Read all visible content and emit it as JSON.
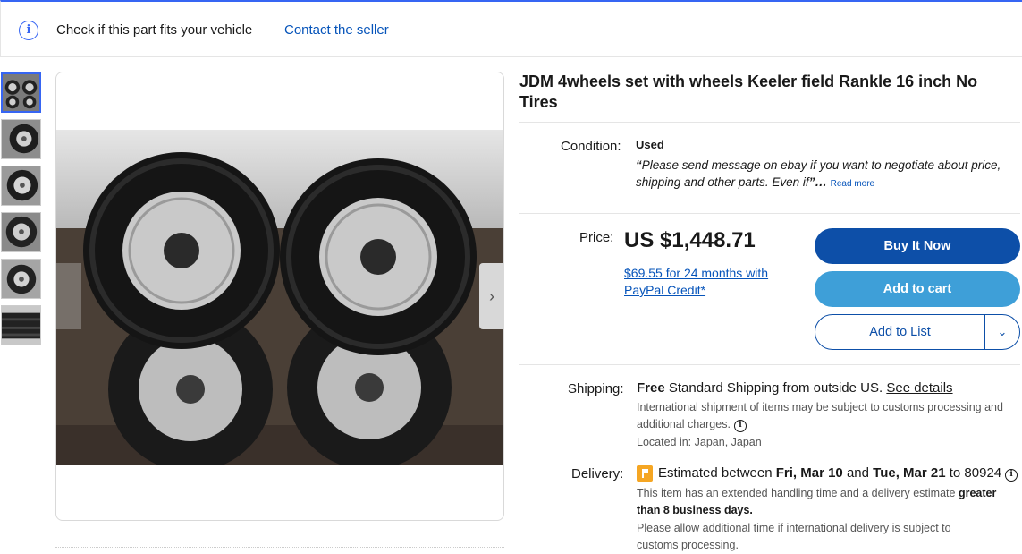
{
  "topbar": {
    "fit_text": "Check if this part fits your vehicle",
    "contact_seller": "Contact the seller"
  },
  "gallery": {
    "thumbnail_count": 6,
    "next_icon": "chevron-right-icon"
  },
  "item": {
    "title": "JDM 4wheels set with wheels Keeler field Rankle 16 inch No Tires"
  },
  "condition": {
    "label": "Condition:",
    "value": "Used",
    "quote_open": "“",
    "quote": "Please send message on ebay if you want to negotiate about price, shipping and other parts. Even if",
    "quote_close": "”…",
    "read_more": "Read more"
  },
  "price": {
    "label": "Price:",
    "value": "US $1,448.71",
    "credit": "$69.55 for 24 months with PayPal Credit*"
  },
  "actions": {
    "buy_now": "Buy It Now",
    "add_to_cart": "Add to cart",
    "add_to_list": "Add to List"
  },
  "shipping": {
    "label": "Shipping:",
    "free": "Free",
    "text": "Standard Shipping from outside US.",
    "see_details": "See details",
    "note": "International shipment of items may be subject to customs processing and additional charges.",
    "location": "Located in: Japan, Japan"
  },
  "delivery": {
    "label": "Delivery:",
    "est_prefix": "Estimated between",
    "date_start": "Fri, Mar 10",
    "and": "and",
    "date_end": "Tue, Mar 21",
    "to": "to 80924",
    "handling_text": "This item has an extended handling time and a delivery estimate",
    "handling_bold": "greater than 8 business days.",
    "intl_note": "Please allow additional time if international delivery is subject to customs processing."
  },
  "colors": {
    "accent_blue": "#3665f3",
    "buy_now_bg": "#0d4fa8",
    "add_to_cart_bg": "#3e9fd8",
    "link": "#0654ba",
    "flag": "#f5a623"
  }
}
